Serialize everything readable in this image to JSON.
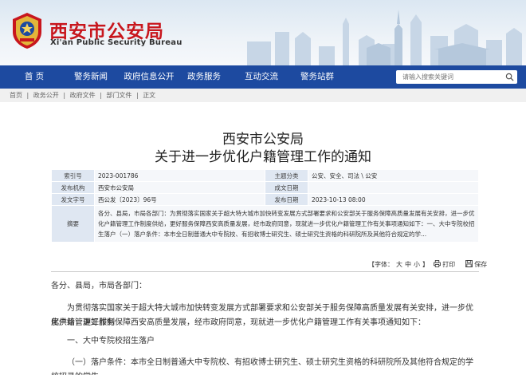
{
  "header": {
    "title": "西安市公安局",
    "subtitle": "Xi'an Public Security Bureau"
  },
  "nav": {
    "items": [
      "首 页",
      "警务新闻",
      "政府信息公开",
      "政务服务",
      "互动交流",
      "警务站群"
    ],
    "search_placeholder": "请输入搜索关键词"
  },
  "breadcrumb": [
    "首页",
    "|",
    "政务公开",
    "|",
    "政府文件",
    "|",
    "部门文件",
    "|",
    "正文"
  ],
  "document": {
    "title_line1": "西安市公安局",
    "title_line2": "关于进一步优化户籍管理工作的通知",
    "info": {
      "index_label": "索引号",
      "index_value": "2023-001786",
      "topic_label": "主题分类",
      "topic_value": "公安、安全、司法 \\ 公安",
      "issuer_label": "发布机构",
      "issuer_value": "西安市公安局",
      "created_label": "成文日期",
      "created_value": "",
      "docno_label": "发文字号",
      "docno_value": "西公发〔2023〕96号",
      "published_label": "发布日期",
      "published_value": "2023-10-13 08:00",
      "abstract_label": "摘要",
      "abstract_value": "各分、县局，市局各部门：为贯彻落实国家关于超大特大城市加快转变发展方式部署要求和公安部关于服务保障高质量发展有关安排，进一步优化户籍管理工作制度供给，更好服务保障西安高质量发展，经市政府同意，现就进一步优化户籍管理工作有关事项通知如下：一、大中专院校招生落户（一）落户条件：本市全日制普通大中专院校、有招收博士研究生、硕士研究生资格的科研院所及其他符合规定的学..."
    },
    "tools": {
      "font_label": "【字体：",
      "font_large": "大",
      "font_medium": "中",
      "font_small": "小",
      "font_end": "】",
      "print": "打印",
      "save": "保存"
    },
    "body": {
      "greeting": "各分、县局，市局各部门：",
      "p1a": "为贯彻落实国家关于超大特大城市加快转变发展方式部署要求和公安部关于服务保障高质量发展有关安排，进一步优化户籍管理工作制",
      "p1b": "度供给，更好服务保障西安高质量发展，经市政府同意，现就进一步优化户籍管理工作有关事项通知如下：",
      "h1": "一、大中专院校招生落户",
      "p2": "（一）落户条件：本市全日制普通大中专院校、有招收博士研究生、硕士研究生资格的科研院所及其他符合规定的学校招录的学生。"
    }
  },
  "colors": {
    "nav_bg": "#1d4aa0",
    "title_red": "#c8161d"
  }
}
